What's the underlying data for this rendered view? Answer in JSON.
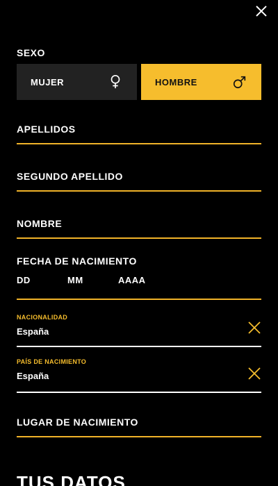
{
  "close_icon": "close-icon",
  "sexo": {
    "label": "SEXO",
    "female_label": "MUJER",
    "male_label": "HOMBRE",
    "selected": "HOMBRE"
  },
  "fields": {
    "apellidos": "APELLIDOS",
    "segundo_apellido": "SEGUNDO APELLIDO",
    "nombre": "NOMBRE",
    "fecha_label": "FECHA DE NACIMIENTO",
    "fecha_dd": "DD",
    "fecha_mm": "MM",
    "fecha_aaaa": "AAAA",
    "lugar": "LUGAR DE NACIMIENTO"
  },
  "nacionalidad": {
    "label": "NACIONALIDAD",
    "value": "España"
  },
  "pais": {
    "label": "PAÍS DE NACIMIENTO",
    "value": "España"
  },
  "section_title": "TUS DATOS",
  "colors": {
    "accent": "#f6bd2d",
    "background": "#000000",
    "dark_button": "#222222"
  }
}
